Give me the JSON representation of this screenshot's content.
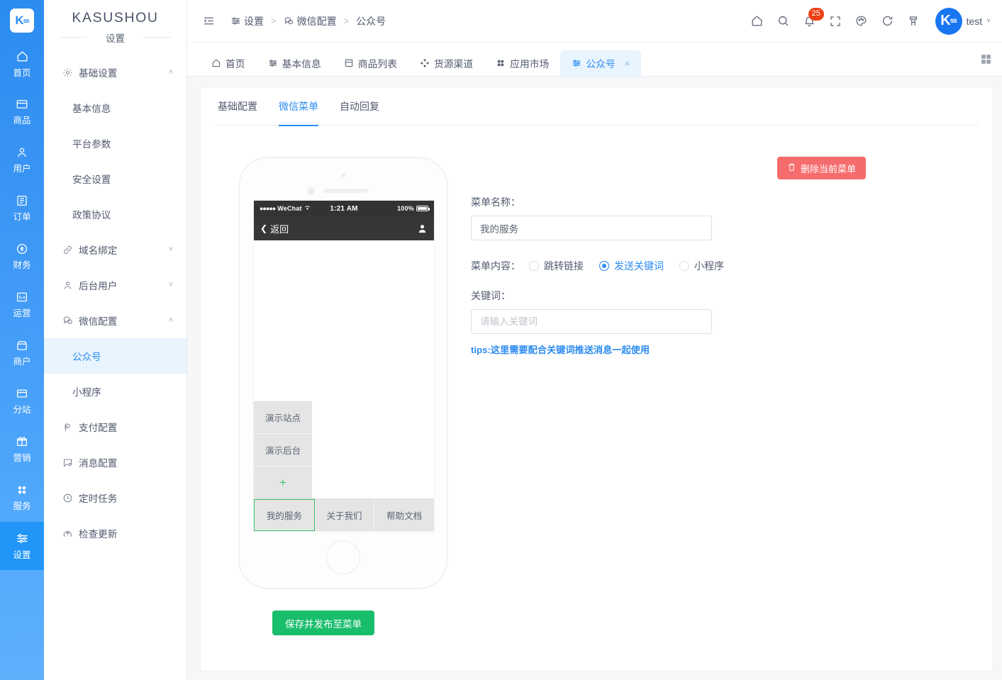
{
  "rail": {
    "logo": {
      "main": "K",
      "sub": "ss",
      "name": "kasushou-logo"
    },
    "items": [
      {
        "label": "首页",
        "icon": "home-icon",
        "active": false
      },
      {
        "label": "商品",
        "icon": "goods-icon",
        "active": false
      },
      {
        "label": "用户",
        "icon": "user-icon",
        "active": false
      },
      {
        "label": "订单",
        "icon": "order-icon",
        "active": false
      },
      {
        "label": "财务",
        "icon": "finance-icon",
        "active": false
      },
      {
        "label": "运营",
        "icon": "operation-icon",
        "active": false
      },
      {
        "label": "商户",
        "icon": "merchant-icon",
        "active": false
      },
      {
        "label": "分站",
        "icon": "substation-icon",
        "active": false
      },
      {
        "label": "营销",
        "icon": "marketing-icon",
        "active": false
      },
      {
        "label": "服务",
        "icon": "service-icon",
        "active": false
      },
      {
        "label": "设置",
        "icon": "settings-icon",
        "active": true
      }
    ]
  },
  "sidebar": {
    "brand": "KASUSHOU",
    "section": "设置",
    "menu": [
      {
        "type": "group",
        "label": "基础设置",
        "icon": "gear-icon",
        "expanded": true,
        "caret": "˄"
      },
      {
        "type": "sub",
        "label": "基本信息",
        "active": false
      },
      {
        "type": "sub",
        "label": "平台参数",
        "active": false
      },
      {
        "type": "sub",
        "label": "安全设置",
        "active": false
      },
      {
        "type": "sub",
        "label": "政策协议",
        "active": false
      },
      {
        "type": "group",
        "label": "域名绑定",
        "icon": "link-icon",
        "expanded": false,
        "caret": "˅"
      },
      {
        "type": "group",
        "label": "后台用户",
        "icon": "person-icon",
        "expanded": false,
        "caret": "˅"
      },
      {
        "type": "group",
        "label": "微信配置",
        "icon": "chat-icon",
        "expanded": true,
        "caret": "˄"
      },
      {
        "type": "sub",
        "label": "公众号",
        "active": true
      },
      {
        "type": "sub",
        "label": "小程序",
        "active": false
      },
      {
        "type": "leaf",
        "label": "支付配置",
        "icon": "pay-icon"
      },
      {
        "type": "leaf",
        "label": "消息配置",
        "icon": "message-icon"
      },
      {
        "type": "leaf",
        "label": "定时任务",
        "icon": "clock-icon"
      },
      {
        "type": "leaf",
        "label": "检查更新",
        "icon": "cloud-upload-icon"
      }
    ]
  },
  "topbar": {
    "fold_icon": "menu-fold-icon",
    "breadcrumb": [
      {
        "label": "设置",
        "icon": "settings-icon"
      },
      {
        "label": "微信配置",
        "icon": "chat-icon"
      },
      {
        "label": "公众号",
        "icon": ""
      }
    ],
    "separator": ">",
    "icons": [
      {
        "name": "home-icon",
        "badge": ""
      },
      {
        "name": "search-icon",
        "badge": ""
      },
      {
        "name": "bell-icon",
        "badge": "25"
      },
      {
        "name": "fullscreen-icon",
        "badge": ""
      },
      {
        "name": "theme-icon",
        "badge": ""
      },
      {
        "name": "refresh-icon",
        "badge": ""
      },
      {
        "name": "clear-cache-icon",
        "badge": ""
      }
    ],
    "user": {
      "avatar_main": "K",
      "avatar_sub": "ss",
      "name": "test",
      "chevron": "˅"
    }
  },
  "tabs": {
    "items": [
      {
        "label": "首页",
        "icon": "home-icon",
        "active": false,
        "closable": false
      },
      {
        "label": "基本信息",
        "icon": "settings-icon",
        "active": false,
        "closable": false
      },
      {
        "label": "商品列表",
        "icon": "goods-icon",
        "active": false,
        "closable": false
      },
      {
        "label": "货源渠道",
        "icon": "channel-icon",
        "active": false,
        "closable": false
      },
      {
        "label": "应用市场",
        "icon": "apps-icon",
        "active": false,
        "closable": false
      },
      {
        "label": "公众号",
        "icon": "settings-icon",
        "active": true,
        "closable": true
      }
    ],
    "close_glyph": "×",
    "grid_icon": "grid-view-icon"
  },
  "subtabs": [
    {
      "label": "基础配置",
      "active": false
    },
    {
      "label": "微信菜单",
      "active": true
    },
    {
      "label": "自动回复",
      "active": false
    }
  ],
  "phone": {
    "status": {
      "dots": "●●●●●",
      "carrier": "WeChat",
      "wifi": "wifi-icon",
      "time": "1:21 AM",
      "battery_pct": "100%"
    },
    "nav": {
      "back_glyph": "❮",
      "back_label": "返回",
      "profile_icon": "person-icon"
    },
    "submenu": [
      {
        "label": "演示站点",
        "type": "item"
      },
      {
        "label": "演示后台",
        "type": "item"
      },
      {
        "label": "+",
        "type": "add"
      }
    ],
    "menubar": [
      {
        "label": "我的服务",
        "selected": true
      },
      {
        "label": "关于我们",
        "selected": false
      },
      {
        "label": "帮助文档",
        "selected": false
      }
    ],
    "save_button": "保存并发布至菜单"
  },
  "form": {
    "delete_button": "删除当前菜单",
    "delete_icon": "trash-icon",
    "name_label": "菜单名称：",
    "name_value": "我的服务",
    "content_label": "菜单内容：",
    "content_options": [
      {
        "label": "跳转链接",
        "selected": false
      },
      {
        "label": "发送关键词",
        "selected": true
      },
      {
        "label": "小程序",
        "selected": false
      }
    ],
    "keyword_label": "关键词：",
    "keyword_value": "",
    "keyword_placeholder": "请输入关键词",
    "tips": "tips:这里需要配合关键词推送消息一起使用"
  },
  "colors": {
    "brand_blue": "#2d8cf0",
    "rail_blue": "#3d97f5",
    "active_rail": "#2196f8",
    "danger_red": "#f56c6c",
    "badge_red": "#ed4014",
    "success_green": "#19be6b",
    "menu_green": "#3cbf6d"
  }
}
